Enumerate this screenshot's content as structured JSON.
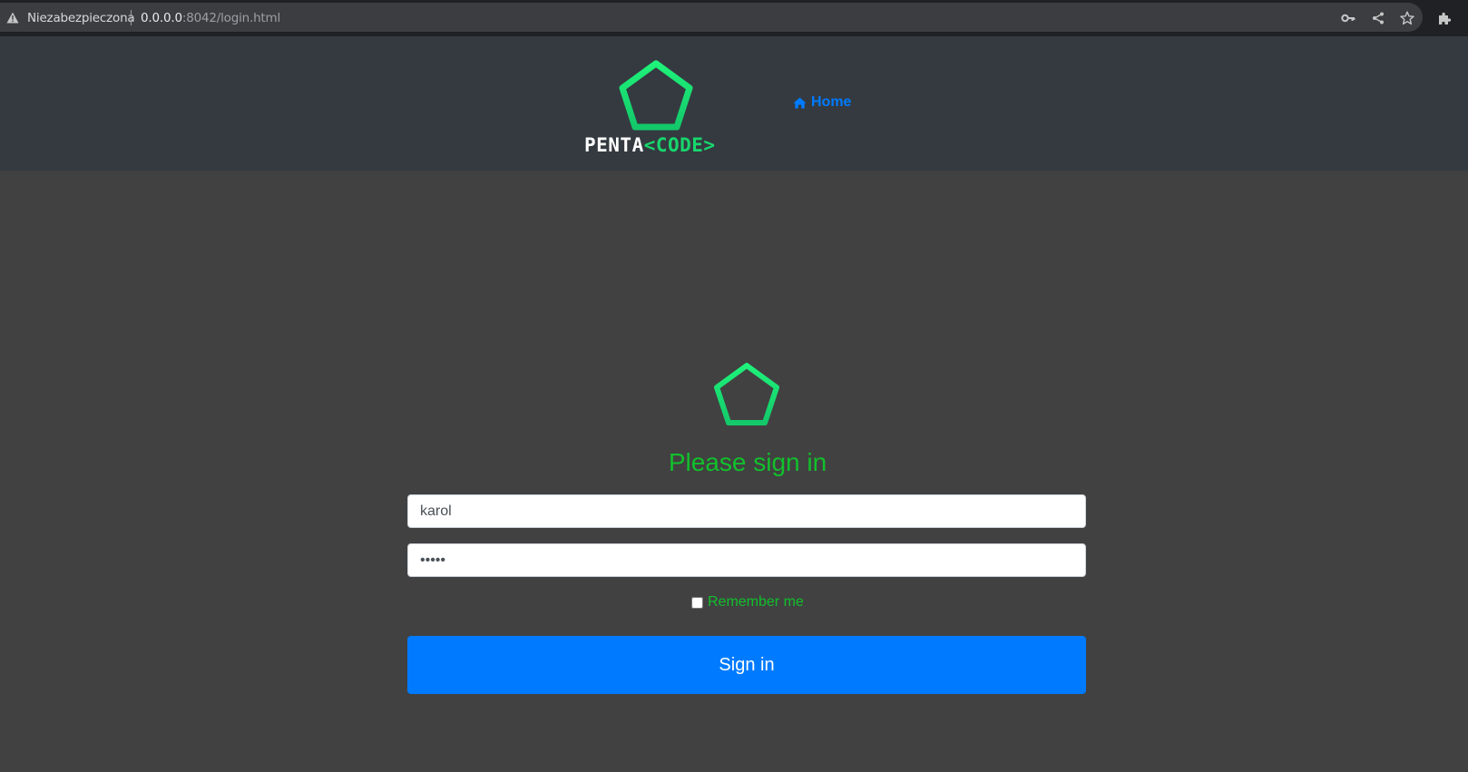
{
  "browser": {
    "security_label": "Niezabezpieczona",
    "url_host": "0.0.0.0",
    "url_rest": ":8042/login.html",
    "toolbar_icons": [
      "key-icon",
      "share-icon",
      "star-icon",
      "extensions-icon"
    ]
  },
  "header": {
    "logo_text_part1": "PENTA",
    "logo_text_part2": "<CODE>",
    "home_label": "Home"
  },
  "form": {
    "title": "Please sign in",
    "username_value": "karol",
    "password_value": "•••••",
    "remember_label": "Remember me",
    "remember_checked": false,
    "submit_label": "Sign in"
  },
  "colors": {
    "brand_green": "#18d66c",
    "title_green": "#11c02c",
    "primary_blue": "#007bff",
    "header_bg": "#343a40",
    "page_bg": "#414141"
  }
}
